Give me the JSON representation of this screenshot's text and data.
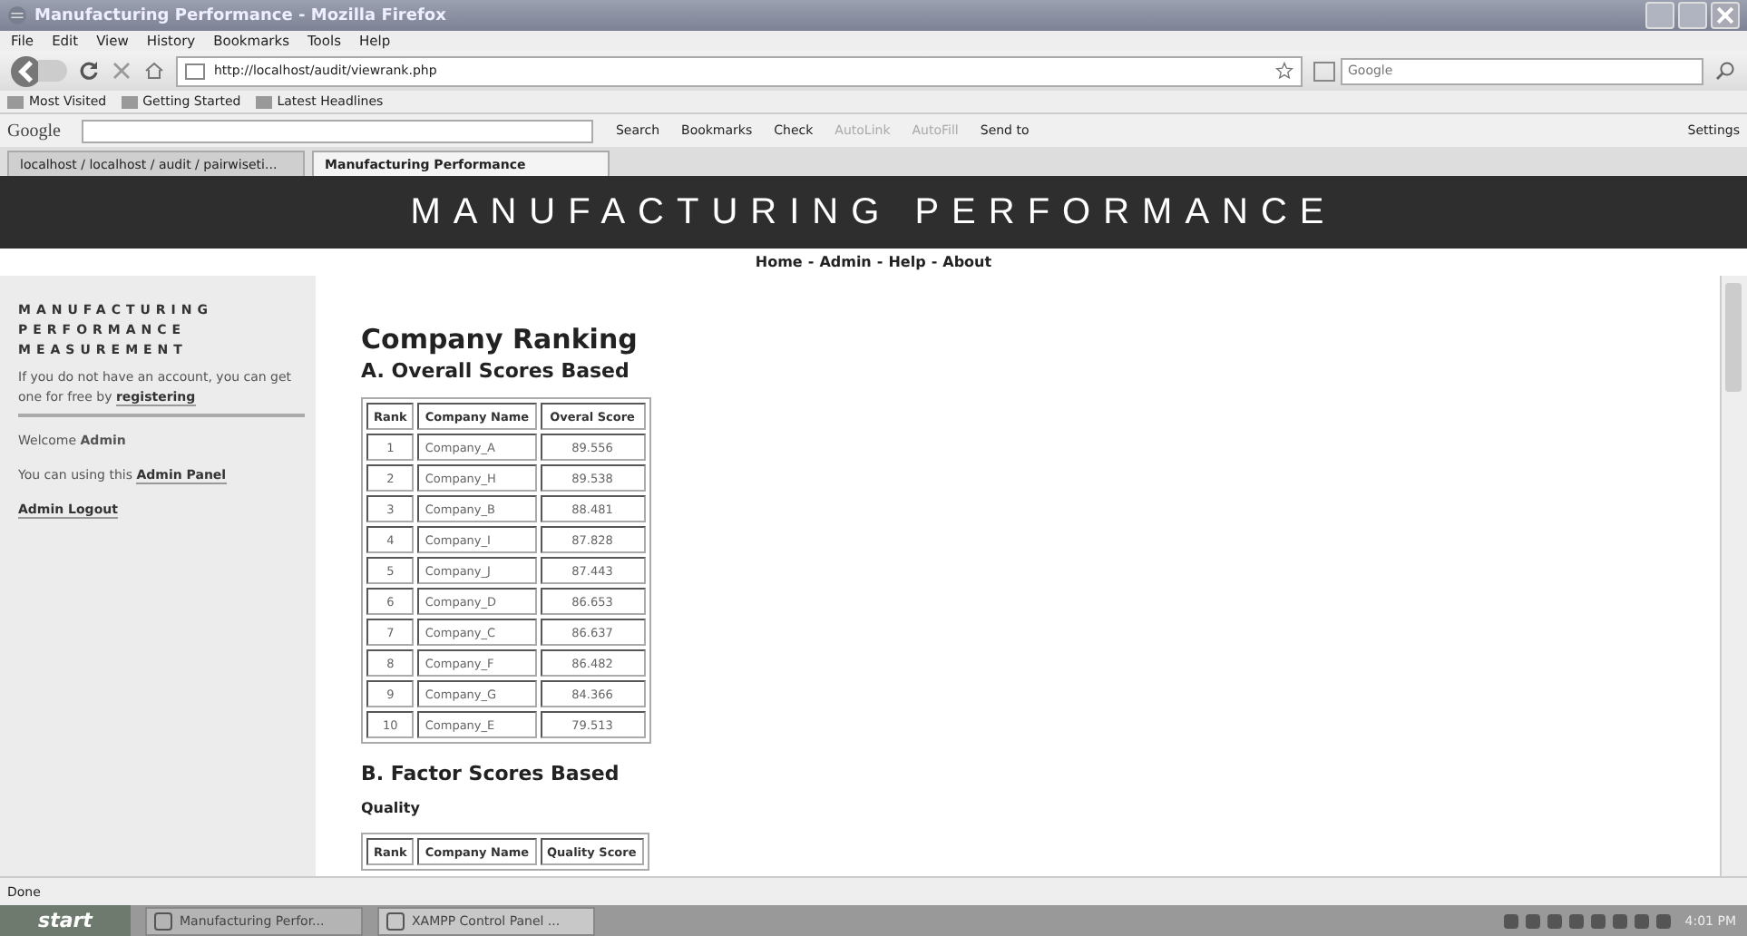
{
  "window": {
    "title": "Manufacturing Performance - Mozilla Firefox"
  },
  "menu": [
    "File",
    "Edit",
    "View",
    "History",
    "Bookmarks",
    "Tools",
    "Help"
  ],
  "address": {
    "value": "http://localhost/audit/viewrank.php"
  },
  "search": {
    "placeholder": "Google"
  },
  "bookmarks": [
    "Most Visited",
    "Getting Started",
    "Latest Headlines"
  ],
  "google_toolbar": {
    "logo": "Google",
    "items": [
      {
        "label": "Search",
        "disabled": false
      },
      {
        "label": "Bookmarks",
        "disabled": false
      },
      {
        "label": "Check",
        "disabled": false
      },
      {
        "label": "AutoLink",
        "disabled": true
      },
      {
        "label": "AutoFill",
        "disabled": true
      },
      {
        "label": "Send to",
        "disabled": false
      }
    ],
    "settings": "Settings"
  },
  "tabs": [
    {
      "label": "localhost / localhost / audit / pairwiseti...",
      "selected": false
    },
    {
      "label": "Manufacturing Performance",
      "selected": true
    }
  ],
  "page": {
    "banner": "MANUFACTURING PERFORMANCE",
    "nav": [
      "Home",
      "Admin",
      "Help",
      "About"
    ],
    "nav_separator": "-",
    "sidebar": {
      "title_lines": [
        "MANUFACTURING",
        "PERFORMANCE",
        "MEASUREMENT"
      ],
      "intro": "If you do not have an account, you can get one for free by",
      "register_link": "registering",
      "welcome": "Welcome",
      "user": "Admin",
      "panel_text": "You can using this",
      "panel_link": "Admin Panel",
      "logout": "Admin Logout"
    },
    "heading": "Company Ranking",
    "section_a": "A. Overall Scores Based",
    "table_a": {
      "columns": [
        "Rank",
        "Company Name",
        "Overal Score"
      ],
      "rows": [
        [
          "1",
          "Company_A",
          "89.556"
        ],
        [
          "2",
          "Company_H",
          "89.538"
        ],
        [
          "3",
          "Company_B",
          "88.481"
        ],
        [
          "4",
          "Company_I",
          "87.828"
        ],
        [
          "5",
          "Company_J",
          "87.443"
        ],
        [
          "6",
          "Company_D",
          "86.653"
        ],
        [
          "7",
          "Company_C",
          "86.637"
        ],
        [
          "8",
          "Company_F",
          "86.482"
        ],
        [
          "9",
          "Company_G",
          "84.366"
        ],
        [
          "10",
          "Company_E",
          "79.513"
        ]
      ]
    },
    "section_b": "B. Factor Scores Based",
    "factor": "Quality",
    "table_b": {
      "columns": [
        "Rank",
        "Company Name",
        "Quality Score"
      ]
    }
  },
  "status_bar": "Done",
  "taskbar": {
    "start": "start",
    "items": [
      {
        "label": "Manufacturing Perfor...",
        "selected": true
      },
      {
        "label": "XAMPP Control Panel ...",
        "selected": false
      }
    ],
    "clock": "4:01 PM"
  }
}
